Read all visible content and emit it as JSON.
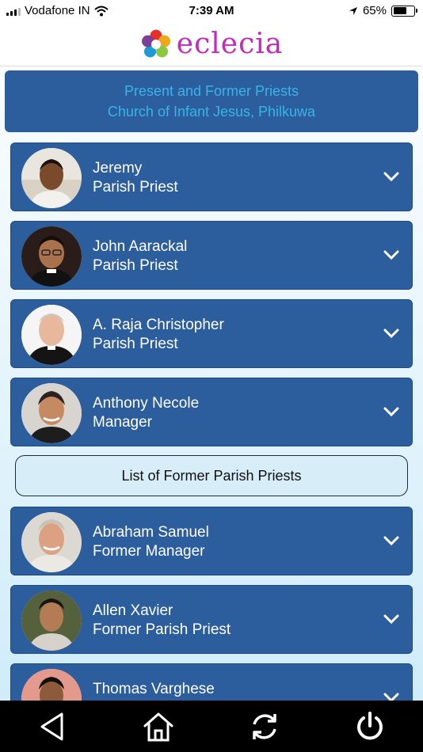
{
  "status_bar": {
    "carrier": "Vodafone IN",
    "time": "7:39 AM",
    "battery": "65%",
    "battery_level": 0.65
  },
  "header": {
    "brand": "eclecia",
    "logo_icon": "colorful-circles-logo"
  },
  "title_card": {
    "line1": "Present and Former Priests",
    "line2": "Church of Infant Jesus, Philkuwa"
  },
  "present_priests": [
    {
      "name": "Jeremy",
      "role": "Parish Priest"
    },
    {
      "name": "John Aarackal",
      "role": "Parish Priest"
    },
    {
      "name": "A. Raja Christopher",
      "role": "Parish Priest"
    },
    {
      "name": "Anthony Necole",
      "role": "Manager"
    }
  ],
  "former_section": {
    "label": "List of Former Parish Priests"
  },
  "former_priests": [
    {
      "name": "Abraham Samuel",
      "role": "Former Manager"
    },
    {
      "name": "Allen Xavier",
      "role": "Former Parish Priest"
    },
    {
      "name": "Thomas Varghese",
      "role": ""
    }
  ],
  "bottom_nav": {
    "icons": [
      "back-triangle-icon",
      "home-icon",
      "refresh-icon",
      "power-icon"
    ]
  },
  "colors": {
    "card": "#2c5d9c",
    "title_text": "#38b4ea",
    "brand": "#c42bbd",
    "section_button": "#d7eef9"
  }
}
